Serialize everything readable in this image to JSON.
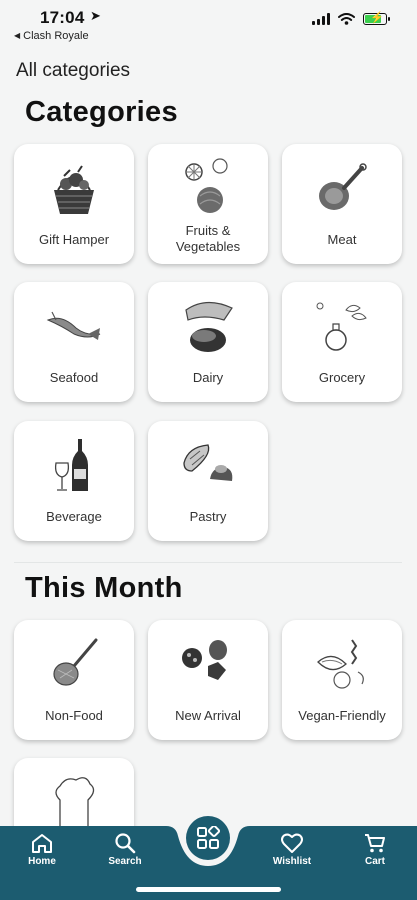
{
  "status_bar": {
    "time": "17:04",
    "back_app": "Clash Royale"
  },
  "subtitle": "All categories",
  "categories_title": "Categories",
  "categories": [
    {
      "label": "Gift Hamper",
      "icon": "gift-hamper-icon"
    },
    {
      "label": "Fruits & Vegetables",
      "icon": "fruits-vegetables-icon"
    },
    {
      "label": "Meat",
      "icon": "meat-icon"
    },
    {
      "label": "Seafood",
      "icon": "seafood-icon"
    },
    {
      "label": "Dairy",
      "icon": "dairy-icon"
    },
    {
      "label": "Grocery",
      "icon": "grocery-icon"
    },
    {
      "label": "Beverage",
      "icon": "beverage-icon"
    },
    {
      "label": "Pastry",
      "icon": "pastry-icon"
    }
  ],
  "this_month_title": "This Month",
  "this_month": [
    {
      "label": "Non-Food",
      "icon": "non-food-icon"
    },
    {
      "label": "New Arrival",
      "icon": "new-arrival-icon"
    },
    {
      "label": "Vegan-Friendly",
      "icon": "vegan-friendly-icon"
    },
    {
      "label": "",
      "icon": "chef-hat-icon"
    }
  ],
  "nav": {
    "home": "Home",
    "search": "Search",
    "wishlist": "Wishlist",
    "cart": "Cart",
    "center_icon": "categories-grid-icon"
  },
  "colors": {
    "nav_bg": "#1c5c70",
    "background": "#f4f5f5",
    "card": "#ffffff"
  }
}
